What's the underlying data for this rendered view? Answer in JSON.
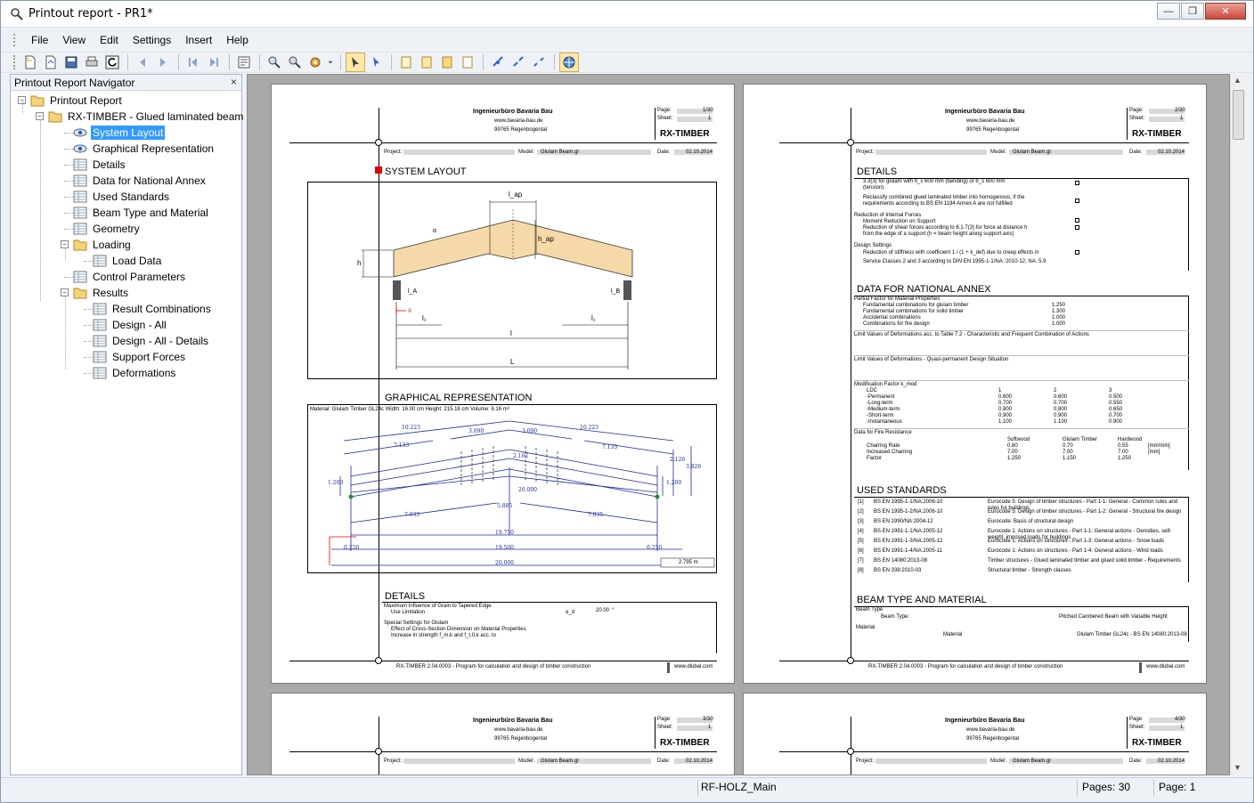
{
  "window": {
    "title": "Printout report - PR1*",
    "min_glyph": "—",
    "max_glyph": "❐",
    "close_glyph": "✕"
  },
  "menu": [
    "File",
    "View",
    "Edit",
    "Settings",
    "Insert",
    "Help"
  ],
  "navigator": {
    "title": "Printout Report Navigator",
    "close_glyph": "×",
    "items": [
      {
        "label": "Printout Report",
        "icon": "folder-icon",
        "level": 0
      },
      {
        "label": "RX-TIMBER - Glued laminated beam",
        "icon": "folder-icon",
        "level": 1
      },
      {
        "label": "System Layout",
        "icon": "eye-icon",
        "level": 2,
        "selected": true
      },
      {
        "label": "Graphical Representation",
        "icon": "eye-icon",
        "level": 2
      },
      {
        "label": "Details",
        "icon": "table-icon",
        "level": 2
      },
      {
        "label": "Data for National Annex",
        "icon": "table-icon",
        "level": 2
      },
      {
        "label": "Used Standards",
        "icon": "table-icon",
        "level": 2
      },
      {
        "label": "Beam Type and Material",
        "icon": "table-icon",
        "level": 2
      },
      {
        "label": "Geometry",
        "icon": "table-icon",
        "level": 2
      },
      {
        "label": "Loading",
        "icon": "folder-icon",
        "level": 2
      },
      {
        "label": "Load Data",
        "icon": "table-icon",
        "level": 3
      },
      {
        "label": "Control Parameters",
        "icon": "table-icon",
        "level": 2
      },
      {
        "label": "Results",
        "icon": "folder-icon",
        "level": 2
      },
      {
        "label": "Result Combinations",
        "icon": "table-icon",
        "level": 3
      },
      {
        "label": "Design - All",
        "icon": "table-icon",
        "level": 3
      },
      {
        "label": "Design - All - Details",
        "icon": "table-icon",
        "level": 3
      },
      {
        "label": "Support Forces",
        "icon": "table-icon",
        "level": 3
      },
      {
        "label": "Deformations",
        "icon": "table-icon",
        "level": 3
      }
    ]
  },
  "pages": {
    "company": "Ingenieurbüro Bavaria Bau",
    "website": "www.bavaria-bau.de",
    "city": "99765 Regenbogental",
    "program": "RX-TIMBER",
    "page_label": "Page:",
    "sheet_label": "Sheet:",
    "project_label": "Project:",
    "model_label": "Model:",
    "model_value": "Glulam Beam.gl",
    "date_label": "Date:",
    "date_value": "02.10.2014",
    "footer_program": "RX-TIMBER 2.04.0003 - Program for calculation and design of timber construction",
    "footer_url": "www.dlubal.com",
    "p1": {
      "page": "1/30",
      "sheet": "1"
    },
    "p2": {
      "page": "2/30",
      "sheet": "1"
    },
    "p3": {
      "page": "3/30",
      "sheet": "1"
    },
    "p4": {
      "page": "4/30",
      "sheet": "1"
    }
  },
  "page1": {
    "sec_system": "SYSTEM LAYOUT",
    "sec_graphical": "GRAPHICAL REPRESENTATION",
    "sec_details": "DETAILS",
    "graph_header": "Material: Glulam Timber GL24c   Width: 16.00 cm   Height: 215.18 cm   Volume: 6.16 m³",
    "dims": {
      "top_left": "10.223",
      "top_right": "10.223",
      "mid_left": "3.090",
      "mid_right": "3.090",
      "lower_left": "7.133",
      "lower_right": "7.133",
      "bottom_left": "7.035",
      "bottom_right": "7.035",
      "center": "5.885",
      "d19750": "19.750",
      "d19500": "19.500",
      "d20000": "20.000",
      "d0250a": "0.250",
      "d0250b": "0.250",
      "v1200a": "1.200",
      "v1200b": "1.200",
      "v2162": "2.162",
      "v2000": "20.000",
      "v2126": "2.126",
      "v3826": "3.826",
      "scale": "2.795 m"
    },
    "details_rows": [
      "Maximum Influence of Grain to Tapered Edge",
      "Use Limitation",
      "Special Settings for Glulam",
      "Effect of Cross-Section Dimension on Material Properties",
      "Increase in strength f_m,k and f_t,0,k acc. to"
    ],
    "details_value": "20.00",
    "details_unit": "°",
    "details_sym": "α_d"
  },
  "page2": {
    "sec_details": "DETAILS",
    "sec_national": "DATA FOR NATIONAL ANNEX",
    "sec_standards": "USED STANDARDS",
    "sec_beam": "BEAM TYPE AND MATERIAL",
    "details_lines": [
      "3.3(3) for glulam with h_s 600 mm (bending) or b_s 600 mm",
      "(tension)",
      "Reclassify combined glued laminated timber into homogenous, if the",
      "requirements according to BS EN 1194 Annex A are not fulfilled",
      "Reduction of Internal Forces",
      "Moment Reduction on Support",
      "Reduction of shear forces according to 6.1.7(3) for force at distance h",
      "from the edge of a support (h = beam height along support axis)",
      "Design Settings",
      "Reduction of stiffness with coefficient 1 / (1 + k_def) due to creep effects in",
      "Service Classes 2 and 3 according to DIN EN 1995-1-1/NA: 2010-12, NA. 5.9"
    ],
    "na_lines": [
      "Partial Factor for Material Properties",
      "Fundamental combinations for glulam timber",
      "Fundamental combinations for solid timber",
      "Accidental combinations",
      "Combinations for fire design",
      "Limit Values of Deformations acc. to Table 7.2 - Characteristic and Frequent Combination of Actions",
      "Limit Values of Deformations - Quasi-permanent Design Situation",
      "Modification Factor k_mod",
      "Data for Fire Resistance"
    ],
    "na_values": [
      "1.250",
      "1.300",
      "1.000",
      "1.000"
    ],
    "kmod_rows": [
      [
        "LDC",
        "1",
        "2",
        "3"
      ],
      [
        "-Permanent",
        "0.600",
        "0.600",
        "0.500"
      ],
      [
        "-Long-term",
        "0.700",
        "0.700",
        "0.550"
      ],
      [
        "-Medium-term",
        "0.800",
        "0.800",
        "0.650"
      ],
      [
        "-Short-term",
        "0.900",
        "0.900",
        "0.700"
      ],
      [
        "-Instantaneous",
        "1.100",
        "1.100",
        "0.900"
      ]
    ],
    "fire_rows": [
      [
        "",
        "Softwood",
        "Glulam Timber",
        "Hardwood",
        ""
      ],
      [
        "Charring Rate",
        "0.80",
        "0.70",
        "0.55",
        "[mm/min]"
      ],
      [
        "Increased Charring",
        "7.00",
        "7.00",
        "7.00",
        "[mm]"
      ],
      [
        "Factor",
        "1.250",
        "1.150",
        "1.250",
        ""
      ]
    ],
    "std_rows": [
      [
        "[1]",
        "BS EN 1995-1-1/NA:2006-10",
        "Eurocode 5: Design of timber structures - Part 1-1: General - Common rules and rules for buildings"
      ],
      [
        "[2]",
        "BS EN 1995-1-2/NA:2006-10",
        "Eurocode 5: Design of timber structures - Part 1-2: General - Structural fire design"
      ],
      [
        "[3]",
        "BS EN 1990/NA:2004-12",
        "Eurocode: Basis of structural design"
      ],
      [
        "[4]",
        "BS EN 1991-1-1/NA:2005-12",
        "Eurocode 1: Actions on structures - Part 1-1: General actions - Densities, self-weight, imposed loads for buildings"
      ],
      [
        "[5]",
        "BS EN 1991-1-3/NA:2005-12",
        "Eurocode 1: Actions on structures - Part 1-3: General actions - Snow loads"
      ],
      [
        "[6]",
        "BS EN 1991-1-4/NA:2005-11",
        "Eurocode 1: Actions on structures - Part 1-4: General actions - Wind loads"
      ],
      [
        "[7]",
        "BS EN 14080:2013-08",
        "Timber structures - Glued laminated timber and glued solid timber - Requirements"
      ],
      [
        "[8]",
        "BS EN 338:2010-03",
        "Structural timber - Strength classes"
      ]
    ],
    "beam_type_label": "Beam Type",
    "beam_type_key": "Beam Type:",
    "beam_type_value": "Pitched Cambered Beam with Variable Height",
    "material_label": "Material",
    "material_key": "Material",
    "material_value": "Glulam Timber GL24c - BS EN 14080:2013-08"
  },
  "status": {
    "main": "RF-HOLZ_Main",
    "pages": "Pages: 30",
    "page": "Page: 1"
  },
  "colors": {
    "selection": "#3399ff",
    "beam": "#f5d9a8",
    "blue": "#1a2a9a",
    "red": "#e00000",
    "green": "#2a8a2a"
  }
}
